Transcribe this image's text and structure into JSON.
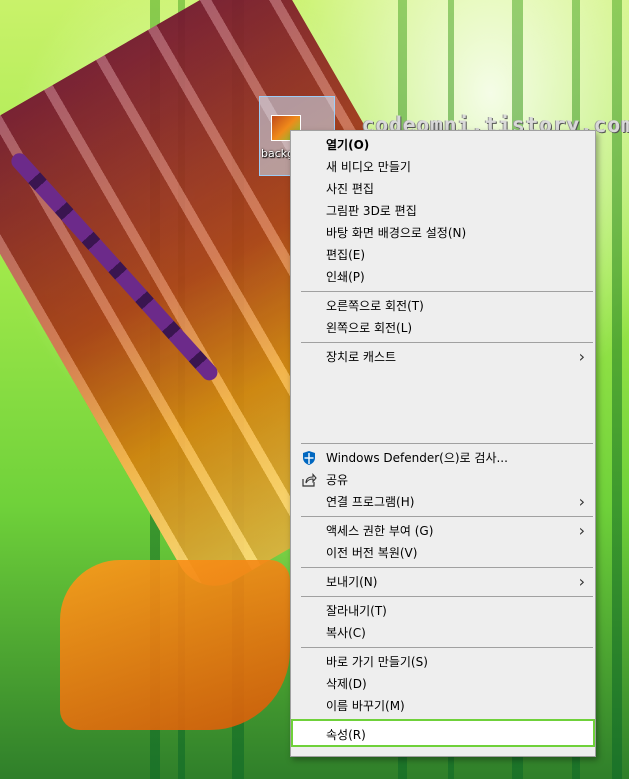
{
  "watermark": "codeomni.tistory.com",
  "desktop_icon": {
    "label": "backg"
  },
  "context_menu": {
    "groups": [
      [
        {
          "label": "열기(O)",
          "default": true
        },
        {
          "label": "새 비디오 만들기"
        },
        {
          "label": "사진 편집"
        },
        {
          "label": "그림판 3D로 편집"
        },
        {
          "label": "바탕 화면 배경으로 설정(N)"
        },
        {
          "label": "편집(E)"
        },
        {
          "label": "인쇄(P)"
        }
      ],
      [
        {
          "label": "오른쪽으로 회전(T)"
        },
        {
          "label": "왼쪽으로 회전(L)"
        }
      ],
      [
        {
          "label": "장치로 캐스트",
          "submenu": true
        }
      ],
      [
        {
          "label": "Windows Defender(으)로 검사...",
          "icon": "windows-defender-shield-icon"
        },
        {
          "label": "공유",
          "icon": "share-icon"
        },
        {
          "label": "연결 프로그램(H)",
          "submenu": true
        }
      ],
      [
        {
          "label": "액세스 권한 부여 (G)",
          "submenu": true
        },
        {
          "label": "이전 버전 복원(V)"
        }
      ],
      [
        {
          "label": "보내기(N)",
          "submenu": true
        }
      ],
      [
        {
          "label": "잘라내기(T)"
        },
        {
          "label": "복사(C)"
        }
      ],
      [
        {
          "label": "바로 가기 만들기(S)"
        },
        {
          "label": "삭제(D)"
        },
        {
          "label": "이름 바꾸기(M)"
        }
      ],
      [
        {
          "label": "속성(R)",
          "highlighted": true
        }
      ]
    ]
  },
  "colors": {
    "menu_background": "#eeeeee",
    "separator": "#a0a0a0",
    "highlight_border": "#6fd13a",
    "defender_blue": "#0067c0"
  }
}
